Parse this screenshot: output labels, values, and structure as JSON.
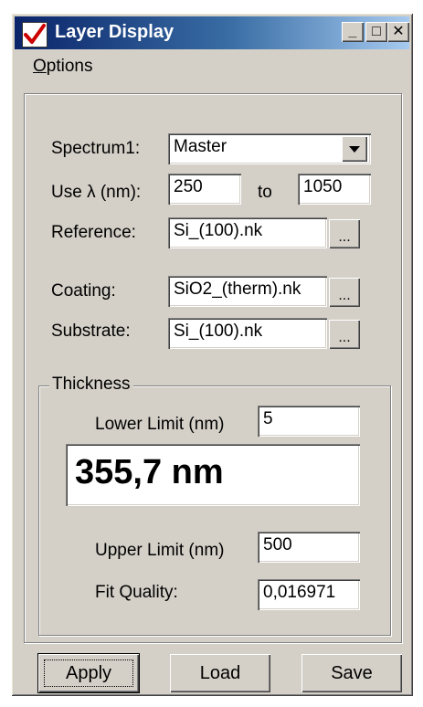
{
  "window": {
    "title": "Layer Display",
    "minimize_label": "_",
    "maximize_label": "□",
    "close_label": "✕"
  },
  "menu": {
    "options_label": "Options"
  },
  "form": {
    "spectrum_label": "Spectrum1:",
    "spectrum_value": "Master",
    "use_lambda_label": "Use λ (nm):",
    "lambda_from": "250",
    "to_label": "to",
    "lambda_to": "1050",
    "reference_label": "Reference:",
    "reference_value": "Si_(100).nk",
    "coating_label": "Coating:",
    "coating_value": "SiO2_(therm).nk",
    "substrate_label": "Substrate:",
    "substrate_value": "Si_(100).nk",
    "browse_label": "..."
  },
  "thickness": {
    "group_label": "Thickness",
    "lower_limit_label": "Lower Limit (nm)",
    "lower_limit_value": "5",
    "result": "355,7 nm",
    "upper_limit_label": "Upper Limit (nm)",
    "upper_limit_value": "500",
    "fit_quality_label": "Fit Quality:",
    "fit_quality_value": "0,016971"
  },
  "buttons": {
    "apply_label": "Apply",
    "load_label": "Load",
    "save_label": "Save"
  },
  "colors": {
    "titlebar_start": "#0a246a",
    "titlebar_end": "#a6caf0",
    "face": "#d4d0c8",
    "logo_check": "#cc0000"
  },
  "icons": {
    "app": "checkmark-icon",
    "dropdown": "chevron-down-icon"
  }
}
